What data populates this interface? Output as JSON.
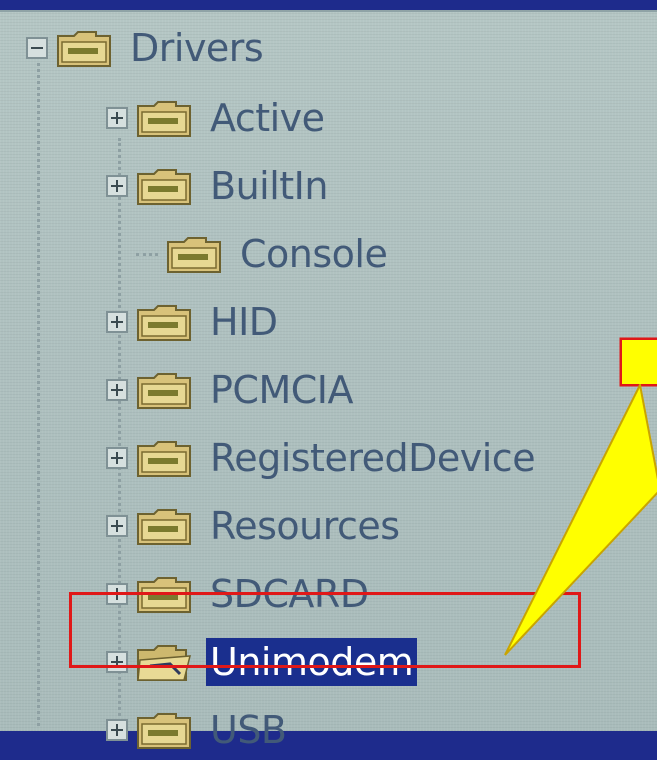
{
  "tree": {
    "root": {
      "label": "Drivers",
      "expander": "minus",
      "icon": "registry-folder-icon"
    },
    "children": [
      {
        "label": "Active",
        "expander": "plus",
        "selected": false
      },
      {
        "label": "BuiltIn",
        "expander": "plus",
        "selected": false
      },
      {
        "label": "Console",
        "expander": "none",
        "selected": false
      },
      {
        "label": "HID",
        "expander": "plus",
        "selected": false
      },
      {
        "label": "PCMCIA",
        "expander": "plus",
        "selected": false
      },
      {
        "label": "RegisteredDevice",
        "expander": "plus",
        "selected": false
      },
      {
        "label": "Resources",
        "expander": "plus",
        "selected": false
      },
      {
        "label": "SDCARD",
        "expander": "plus",
        "selected": false
      },
      {
        "label": "Unimodem",
        "expander": "plus",
        "selected": true
      },
      {
        "label": "USB",
        "expander": "plus",
        "selected": false
      }
    ]
  },
  "annotation": {
    "highlight_color": "#e01818",
    "callout_fill": "#ffff00",
    "callout_text": ""
  },
  "colors": {
    "title_bar": "#1e2b8c",
    "panel_bg": "#aec0bf",
    "selection_bg": "#1a2f8e",
    "text": "#425a78"
  }
}
